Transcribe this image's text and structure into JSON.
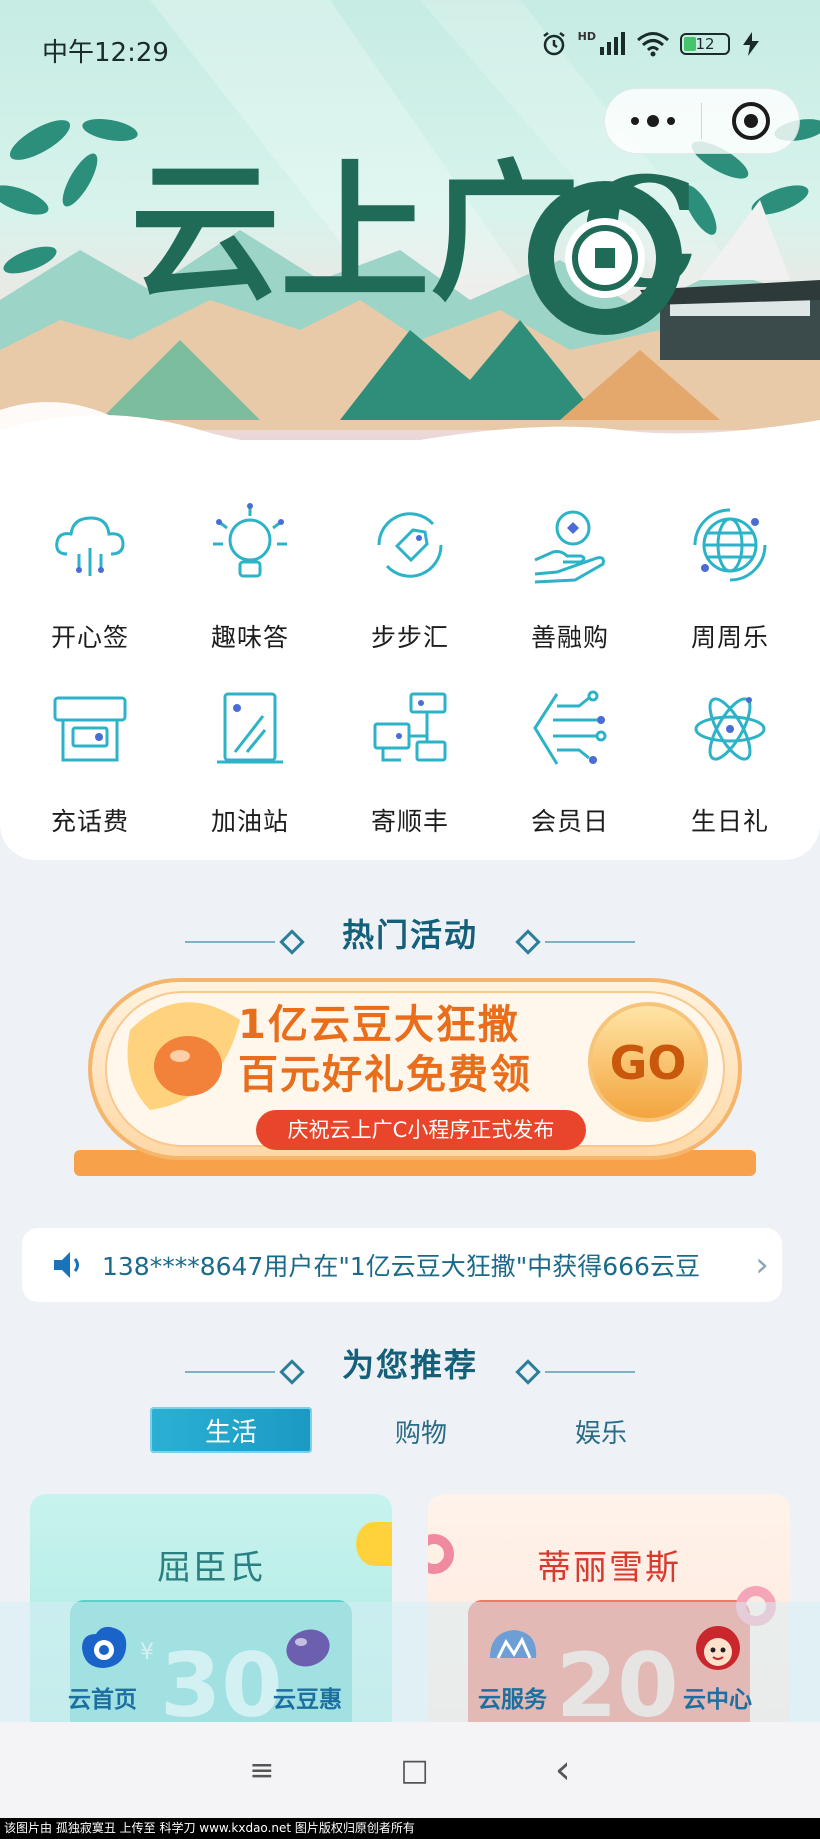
{
  "status_bar": {
    "time": "中午12:29",
    "battery": "12",
    "network": "HD"
  },
  "banner": {
    "title": "云上广C"
  },
  "grid": [
    {
      "label": "开心签",
      "icon": "cloud-sign-icon"
    },
    {
      "label": "趣味答",
      "icon": "lightbulb-icon"
    },
    {
      "label": "步步汇",
      "icon": "tag-cycle-icon"
    },
    {
      "label": "善融购",
      "icon": "hand-gift-icon"
    },
    {
      "label": "周周乐",
      "icon": "globe-icon"
    },
    {
      "label": "充话费",
      "icon": "topup-machine-icon"
    },
    {
      "label": "加油站",
      "icon": "fuel-station-icon"
    },
    {
      "label": "寄顺丰",
      "icon": "delivery-network-icon"
    },
    {
      "label": "会员日",
      "icon": "circuit-icon"
    },
    {
      "label": "生日礼",
      "icon": "atom-icon"
    }
  ],
  "hot": {
    "title": "热门活动",
    "promo_line1": "1亿云豆大狂撒",
    "promo_line2": "百元好礼免费领",
    "promo_button": "GO",
    "promo_ribbon": "庆祝云上广C小程序正式发布"
  },
  "ticker": {
    "text": "138****8647用户在\"1亿云豆大狂撒\"中获得666云豆"
  },
  "recommend": {
    "title": "为您推荐",
    "tabs": [
      "生活",
      "购物",
      "娱乐"
    ],
    "cards": [
      {
        "brand": "屈臣氏",
        "amount": "30",
        "currency": "¥"
      },
      {
        "brand": "蒂丽雪斯",
        "amount": "20"
      }
    ]
  },
  "bottom_nav": [
    {
      "label": "云首页",
      "icon": "home-cloud-icon"
    },
    {
      "label": "云豆惠",
      "icon": "bean-icon"
    },
    {
      "label": "云服务",
      "icon": "service-cloud-icon"
    },
    {
      "label": "云中心",
      "icon": "avatar-icon"
    }
  ],
  "system_nav": {
    "menu": "≡",
    "home": "□",
    "back": "‹"
  },
  "footer_note": "该图片由 孤独寂寞丑 上传至 科学刀 www.kxdao.net 图片版权归原创者所有",
  "colors": {
    "accent": "#14607a",
    "tab_active": "#1a9ac3",
    "icon_teal": "#2cb3c8",
    "promo_orange": "#f39a3c"
  }
}
